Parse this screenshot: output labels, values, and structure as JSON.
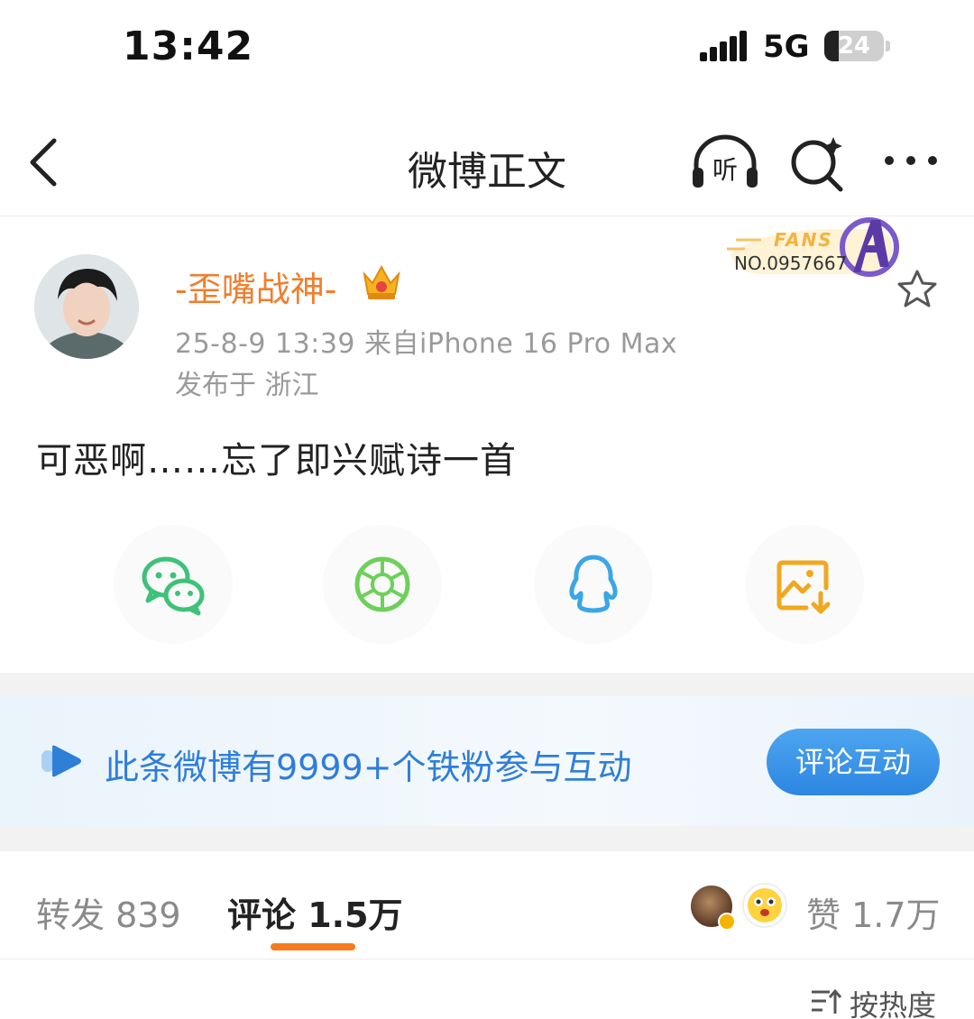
{
  "status_bar": {
    "time": "13:42",
    "network": "5G",
    "battery": "24",
    "battery_level": 0.24
  },
  "nav": {
    "title": "微博正文",
    "listen_label": "听"
  },
  "post": {
    "user_name": "-歪嘴战神-",
    "fans_badge_word": "FANS",
    "fans_badge_number": "NO.0957667",
    "meta": "25-8-9 13:39  来自iPhone 16 Pro Max",
    "location": "发布于 浙江",
    "text": "可恶啊……忘了即兴赋诗一首"
  },
  "share": {
    "items": [
      "wechat-icon",
      "moments-icon",
      "qq-icon",
      "save-image-icon"
    ]
  },
  "banner": {
    "text": "此条微博有9999+个铁粉参与互动",
    "button_label": "评论互动"
  },
  "tabs": {
    "repost": "转发 839",
    "comment": "评论 1.5万",
    "like": "赞 1.7万"
  },
  "sort": {
    "label": "按热度"
  },
  "colors": {
    "username": "#f07e2c",
    "accent_blue": "#2f7ed8",
    "tab_indicator": "#f57c1e",
    "wechat": "#3fc17a",
    "moments": "#6fcf5b",
    "qq": "#3ba6e5",
    "save": "#f0a81f"
  }
}
